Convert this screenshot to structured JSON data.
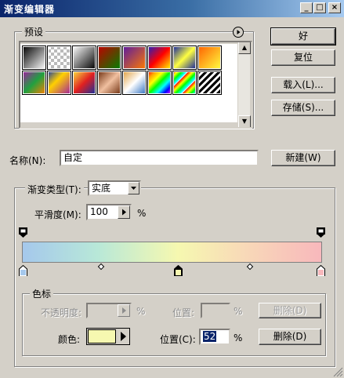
{
  "window": {
    "title": "渐变编辑器"
  },
  "titlebar_buttons": {
    "minimize": "_",
    "maximize": "□",
    "close": "×"
  },
  "presets": {
    "label": "预设",
    "menu_icon": "play-circle-icon"
  },
  "buttons": {
    "ok": "好",
    "reset": "复位",
    "load": "载入(L)...",
    "save": "存储(S)...",
    "new": "新建(W)",
    "delete_opacity": "删除(D)",
    "delete_color": "删除(D)"
  },
  "name": {
    "label": "名称(N):",
    "value": "自定"
  },
  "gradient_type": {
    "label": "渐变类型(T):",
    "value": "实底"
  },
  "smoothness": {
    "label": "平滑度(M):",
    "value": "100",
    "unit": "%"
  },
  "stops": {
    "group_label": "色标",
    "opacity_label": "不透明度:",
    "opacity_unit": "%",
    "opacity_location_label": "位置:",
    "opacity_location_unit": "%",
    "color_label": "颜色:",
    "color_value": "#f6f8b0",
    "location_label": "位置(C):",
    "location_value": "52",
    "location_unit": "%"
  },
  "gradient": {
    "colors": [
      "#a5c8ec",
      "#b8e8d8",
      "#f6f8b0",
      "#f8d8b8",
      "#f8b8bc"
    ],
    "color_stops_percent": [
      0,
      52,
      100
    ],
    "midpoints_percent": [
      26,
      76
    ],
    "opacity_stops_percent": [
      0,
      100
    ]
  }
}
